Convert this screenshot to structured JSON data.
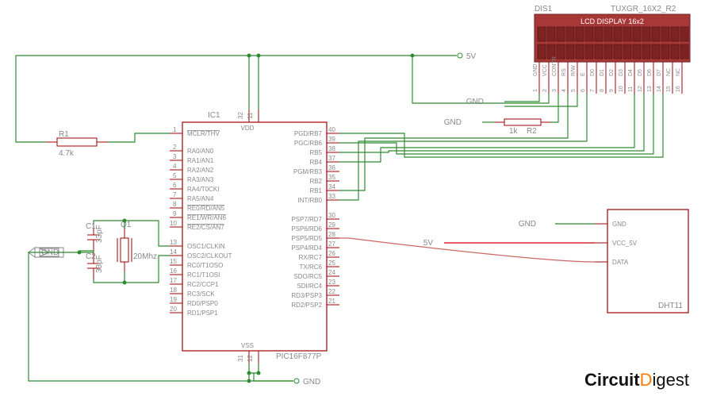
{
  "ic1": {
    "ref": "IC1",
    "part": "PIC16F877P",
    "left_pins": [
      {
        "num": "1",
        "name": "MCLR/THV",
        "over": true
      },
      {
        "num": "2",
        "name": "RA0/AN0"
      },
      {
        "num": "3",
        "name": "RA1/AN1"
      },
      {
        "num": "4",
        "name": "RA2/AN2"
      },
      {
        "num": "5",
        "name": "RA3/AN3"
      },
      {
        "num": "6",
        "name": "RA4/T0CKI"
      },
      {
        "num": "7",
        "name": "RA5/AN4"
      },
      {
        "num": "8",
        "name": "RE0/RD/AN5",
        "over": true
      },
      {
        "num": "9",
        "name": "RE1/WR/AN6",
        "over": true
      },
      {
        "num": "10",
        "name": "RE2/CS/AN7",
        "over": true
      },
      {
        "num": "13",
        "name": "OSC1/CLKIN"
      },
      {
        "num": "14",
        "name": "OSC2/CLKOUT"
      },
      {
        "num": "15",
        "name": "RC0/T1OSO"
      },
      {
        "num": "16",
        "name": "RC1/T1OSI"
      },
      {
        "num": "17",
        "name": "RC2/CCP1"
      },
      {
        "num": "18",
        "name": "RC3/SCK"
      },
      {
        "num": "19",
        "name": "RD0/PSP0"
      },
      {
        "num": "20",
        "name": "RD1/PSP1"
      }
    ],
    "right_pins": [
      {
        "num": "40",
        "name": "PGD/RB7"
      },
      {
        "num": "39",
        "name": "PGC/RB6"
      },
      {
        "num": "38",
        "name": "RB5"
      },
      {
        "num": "37",
        "name": "RB4"
      },
      {
        "num": "36",
        "name": "PGM/RB3"
      },
      {
        "num": "35",
        "name": "RB2"
      },
      {
        "num": "34",
        "name": "RB1"
      },
      {
        "num": "33",
        "name": "INT/RB0"
      },
      {
        "num": "30",
        "name": "PSP7/RD7"
      },
      {
        "num": "29",
        "name": "PSP6/RD6"
      },
      {
        "num": "28",
        "name": "PSP5/RD5"
      },
      {
        "num": "27",
        "name": "PSP4/RD4"
      },
      {
        "num": "26",
        "name": "RX/RC7"
      },
      {
        "num": "25",
        "name": "TX/RC6"
      },
      {
        "num": "24",
        "name": "SDO/RC5"
      },
      {
        "num": "23",
        "name": "SDI/RC4"
      },
      {
        "num": "22",
        "name": "RD3/PSP3"
      },
      {
        "num": "21",
        "name": "RD2/PSP2"
      }
    ],
    "top_pins": [
      {
        "num": "32",
        "name": "VDD"
      },
      {
        "num": "11",
        "name": ""
      }
    ],
    "bot_pins": [
      {
        "num": "31",
        "name": "VSS"
      },
      {
        "num": "12",
        "name": ""
      }
    ]
  },
  "lcd": {
    "ref": "DIS1",
    "part": "TUXGR_16X2_R2",
    "title": "LCD DISPLAY 16x2",
    "pins": [
      "GND",
      "VCC",
      "CONTR",
      "RS",
      "R/W",
      "E",
      "D0",
      "D1",
      "D2",
      "D3",
      "D4",
      "D5",
      "D6",
      "D7",
      "NC",
      "NC"
    ],
    "pin_nums": [
      "1",
      "2",
      "3",
      "4",
      "5",
      "6",
      "7",
      "8",
      "9",
      "10",
      "11",
      "12",
      "13",
      "14",
      "15",
      "16"
    ]
  },
  "dht": {
    "ref": "DHT11",
    "pins": [
      "GND",
      "VCC_5V",
      "DATA"
    ]
  },
  "r1": {
    "ref": "R1",
    "val": "4.7k"
  },
  "r2": {
    "ref": "R2",
    "val": "1k"
  },
  "c1": {
    "ref": "C1",
    "val": "33pF"
  },
  "c2": {
    "ref": "C2",
    "val": "33pF"
  },
  "q1": {
    "ref": "Q1",
    "val": "20Mhz"
  },
  "netlabels": {
    "v5_top": "5V",
    "v5_dht": "5V",
    "gnd_lcd1": "GND",
    "gnd_lcd2": "GND",
    "gnd_dht": "GND",
    "gnd_left": "GND",
    "gnd_bot": "GND"
  },
  "logo": {
    "brand": "Circuit",
    "accent": "D",
    "rest": "igest"
  }
}
